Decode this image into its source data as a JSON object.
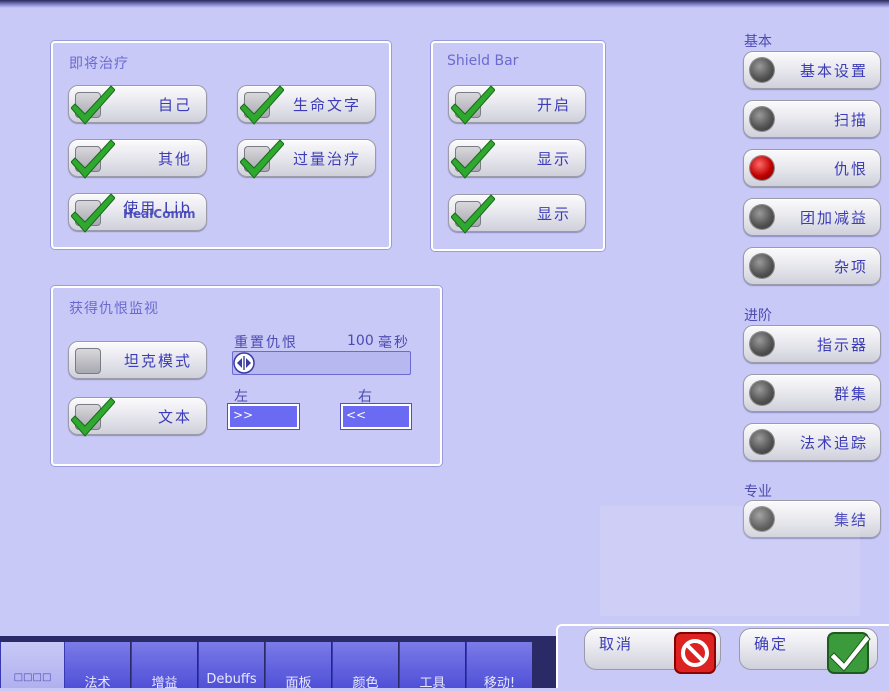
{
  "incoming_heal": {
    "title": "即将治疗",
    "options": [
      {
        "label": "自己",
        "checked": true
      },
      {
        "label": "生命文字",
        "checked": true
      },
      {
        "label": "其他",
        "checked": true
      },
      {
        "label": "过量治疗",
        "checked": true
      },
      {
        "label": "使用 Lib",
        "sub": "HealComm",
        "checked": true
      }
    ]
  },
  "shield_bar": {
    "title": "Shield Bar",
    "options": [
      {
        "label": "开启",
        "checked": true
      },
      {
        "label": "显示",
        "checked": true
      },
      {
        "label": "显示",
        "checked": true
      }
    ]
  },
  "threat": {
    "title": "获得仇恨监视",
    "tank_mode": {
      "label": "坦克模式",
      "checked": false
    },
    "text": {
      "label": "文本",
      "checked": true
    },
    "reset_label": "重置仇恨",
    "reset_value": "100",
    "reset_unit": "毫秒",
    "left_label": "左",
    "right_label": "右",
    "left_value": ">>",
    "right_value": "<<"
  },
  "sidebar": {
    "basic_header": "基本",
    "advanced_header": "进阶",
    "pro_header": "专业",
    "items": [
      {
        "label": "基本设置",
        "active": false
      },
      {
        "label": "扫描",
        "active": false
      },
      {
        "label": "仇恨",
        "active": true
      },
      {
        "label": "团加减益",
        "active": false
      },
      {
        "label": "杂项",
        "active": false
      },
      {
        "label": "指示器",
        "active": false
      },
      {
        "label": "群集",
        "active": false
      },
      {
        "label": "法术追踪",
        "active": false
      },
      {
        "label": "集结",
        "active": false
      }
    ]
  },
  "tabs": [
    "□□□□",
    "法术",
    "增益",
    "Debuffs",
    "面板",
    "颜色",
    "工具",
    "移动!"
  ],
  "footer": {
    "cancel": "取消",
    "ok": "确定"
  },
  "colors": {
    "background": "#c9c9f7",
    "accent": "#6a6af2",
    "active_dot": "#c00000",
    "check": "#2fa82f"
  }
}
